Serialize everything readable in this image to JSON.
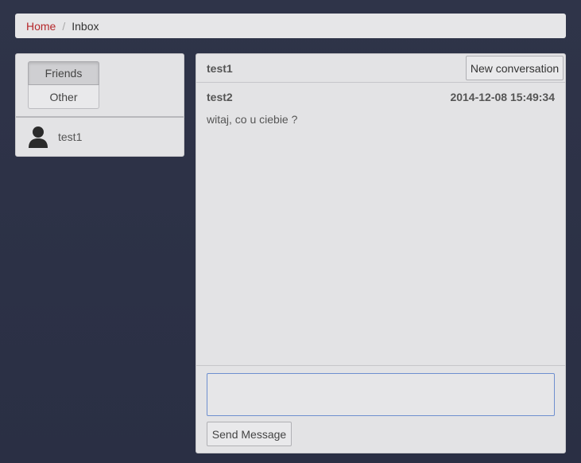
{
  "breadcrumb": {
    "home": "Home",
    "separator": "/",
    "current": "Inbox"
  },
  "sidebar": {
    "tabs": [
      {
        "label": "Friends",
        "active": true
      },
      {
        "label": "Other",
        "active": false
      }
    ],
    "friends": [
      {
        "name": "test1",
        "icon": "user-silhouette-icon"
      }
    ]
  },
  "conversation": {
    "title": "test1",
    "new_conversation_label": "New conversation",
    "messages": [
      {
        "author": "test2",
        "timestamp": "2014-12-08 15:49:34",
        "text": "witaj, co u ciebie ?"
      }
    ]
  },
  "composer": {
    "value": "",
    "send_label": "Send Message"
  },
  "colors": {
    "accent": "#b5282b",
    "background": "#2c3147",
    "panel": "#e3e3e5",
    "focus_border": "#6e8fcf"
  }
}
